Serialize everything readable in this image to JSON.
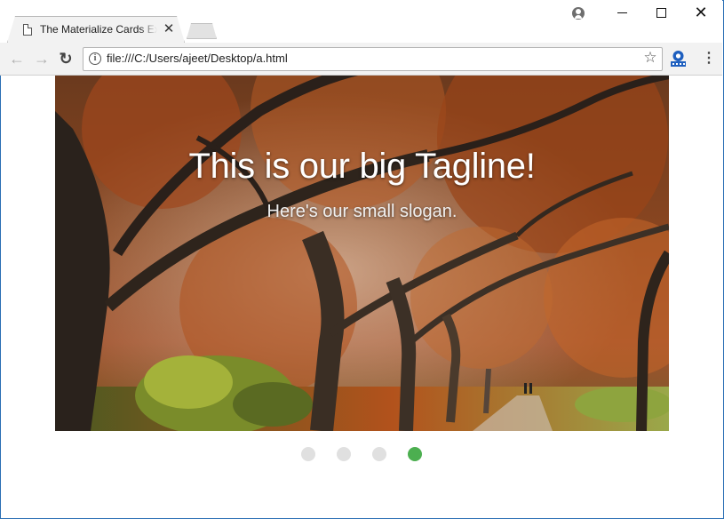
{
  "browser": {
    "tab": {
      "title": "The Materialize Cards Example",
      "close_symbol": "✕",
      "icon": "document-icon"
    },
    "window_controls": {
      "profile_icon": "profile-icon",
      "minimize_icon": "minimize-icon",
      "maximize_icon": "maximize-icon",
      "close_symbol": "✕"
    },
    "toolbar": {
      "back_symbol": "←",
      "forward_symbol": "→",
      "reload_symbol": "↻",
      "info_symbol": "i",
      "url": "file:///C:/Users/ajeet/Desktop/a.html",
      "bookmark_symbol": "☆",
      "menu_symbol": "⋮",
      "extension_icon": "extension-icon"
    }
  },
  "slider": {
    "slides": [
      {
        "title": "This is our big Tagline!",
        "subtitle": "Here's our small slogan.",
        "image": "autumn-trees-park"
      }
    ],
    "indicator_count": 4,
    "active_index": 3
  },
  "colors": {
    "indicator_active": "#4caf50",
    "indicator_inactive": "#e0e0e0",
    "window_border": "#2b6fb4"
  }
}
